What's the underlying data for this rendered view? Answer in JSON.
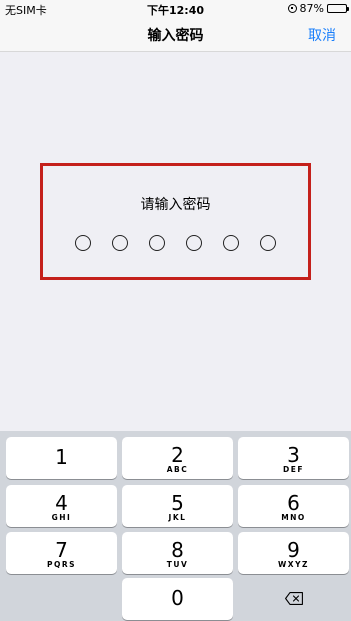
{
  "status_bar": {
    "carrier": "无SIM卡",
    "time": "下午12:40",
    "battery": "87%",
    "battery_level": 0.87
  },
  "nav": {
    "title": "输入密码",
    "cancel_label": "取消"
  },
  "prompt": {
    "label": "请输入密码",
    "digit_count": 6,
    "filled": 0
  },
  "keypad": {
    "keys": [
      {
        "num": "1",
        "letters": ""
      },
      {
        "num": "2",
        "letters": "ABC"
      },
      {
        "num": "3",
        "letters": "DEF"
      },
      {
        "num": "4",
        "letters": "GHI"
      },
      {
        "num": "5",
        "letters": "JKL"
      },
      {
        "num": "6",
        "letters": "MNO"
      },
      {
        "num": "7",
        "letters": "PQRS"
      },
      {
        "num": "8",
        "letters": "TUV"
      },
      {
        "num": "9",
        "letters": "WXYZ"
      },
      {
        "num": "0",
        "letters": ""
      }
    ],
    "delete_icon": "backspace-icon"
  },
  "colors": {
    "accent": "#1a7ffb",
    "highlight_border": "#c4201b",
    "keypad_bg": "#d1d5db"
  }
}
